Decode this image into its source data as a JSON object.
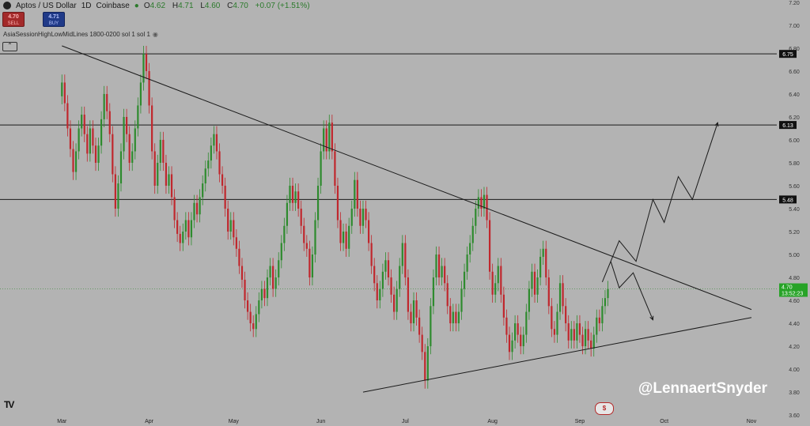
{
  "header": {
    "symbol": "Aptos / US Dollar",
    "interval": "1D",
    "exchange": "Coinbase",
    "o_label": "O",
    "o_value": "4.62",
    "h_label": "H",
    "h_value": "4.71",
    "l_label": "L",
    "l_value": "4.60",
    "c_label": "C",
    "c_value": "4.70",
    "change": "+0.07 (+1.51%)"
  },
  "trade": {
    "sell_price": "4.70",
    "sell_label": "SELL",
    "buy_price": "4.71",
    "buy_label": "BUY"
  },
  "indicator": {
    "label": "AsiaSessionHighLowMidLines 1800-0200 sol 1 sol 1",
    "collapse_glyph": "⌃"
  },
  "watermark": "@LennaertSnyder",
  "icons": {
    "logo": "aptos-logo-icon",
    "eye": "eye-icon",
    "tv": "tradingview-icon",
    "events": "earnings-event-icon"
  },
  "colors": {
    "background": "#b3b3b3",
    "up": "#2e8b2e",
    "down": "#c0272d",
    "line": "#1a1a1a",
    "last_price": "#27a327"
  },
  "chart_data": {
    "type": "candlestick",
    "title": "Aptos / US Dollar",
    "x_ticks": [
      {
        "label": "Mar",
        "t": 0
      },
      {
        "label": "Apr",
        "t": 31
      },
      {
        "label": "May",
        "t": 61
      },
      {
        "label": "Jun",
        "t": 92
      },
      {
        "label": "Jul",
        "t": 122
      },
      {
        "label": "Aug",
        "t": 153
      },
      {
        "label": "Sep",
        "t": 184
      },
      {
        "label": "Oct",
        "t": 214
      },
      {
        "label": "Nov",
        "t": 245
      }
    ],
    "x_range": [
      -22,
      254
    ],
    "ylim": [
      3.58,
      7.22
    ],
    "y_ticks": [
      "7.20",
      "7.00",
      "6.80",
      "6.60",
      "6.40",
      "6.20",
      "6.00",
      "5.80",
      "5.60",
      "5.40",
      "5.20",
      "5.00",
      "4.80",
      "4.60",
      "4.40",
      "4.20",
      "4.00",
      "3.80",
      "3.60"
    ],
    "horizontal_levels": [
      {
        "label": "6.75",
        "value": 6.75
      },
      {
        "label": "6.13",
        "value": 6.13
      },
      {
        "label": "5.48",
        "value": 5.48
      }
    ],
    "last_price": {
      "value": 4.7,
      "label": "4.70",
      "countdown": "13:52:23"
    },
    "trendlines": [
      {
        "points": [
          [
            0,
            6.82
          ],
          [
            245,
            4.52
          ]
        ]
      },
      {
        "points": [
          [
            107,
            3.8
          ],
          [
            245,
            4.45
          ]
        ]
      }
    ],
    "projection_up": [
      [
        192,
        4.76
      ],
      [
        198,
        5.12
      ],
      [
        204,
        4.94
      ],
      [
        210,
        5.48
      ],
      [
        214,
        5.28
      ],
      [
        219,
        5.68
      ],
      [
        224,
        5.48
      ],
      [
        233,
        6.15
      ]
    ],
    "projection_down": [
      [
        195,
        4.94
      ],
      [
        198,
        4.71
      ],
      [
        203,
        4.84
      ],
      [
        210,
        4.43
      ]
    ],
    "candles": [
      {
        "o": 6.38,
        "c": 6.5
      },
      {
        "o": 6.5,
        "c": 6.32
      },
      {
        "o": 6.32,
        "c": 6.1
      },
      {
        "o": 6.1,
        "c": 5.92
      },
      {
        "o": 5.92,
        "c": 5.72
      },
      {
        "o": 5.72,
        "c": 5.9
      },
      {
        "o": 5.9,
        "c": 6.1
      },
      {
        "o": 6.1,
        "c": 6.22
      },
      {
        "o": 6.22,
        "c": 6.05
      },
      {
        "o": 6.05,
        "c": 5.88
      },
      {
        "o": 5.88,
        "c": 6.1
      },
      {
        "o": 6.1,
        "c": 5.95
      },
      {
        "o": 5.95,
        "c": 5.8
      },
      {
        "o": 5.8,
        "c": 5.95
      },
      {
        "o": 5.95,
        "c": 6.18
      },
      {
        "o": 6.18,
        "c": 6.4
      },
      {
        "o": 6.4,
        "c": 6.25
      },
      {
        "o": 6.25,
        "c": 6.05
      },
      {
        "o": 6.05,
        "c": 5.7
      },
      {
        "o": 5.7,
        "c": 5.4
      },
      {
        "o": 5.4,
        "c": 5.62
      },
      {
        "o": 5.62,
        "c": 5.9
      },
      {
        "o": 5.9,
        "c": 6.2
      },
      {
        "o": 6.2,
        "c": 6.05
      },
      {
        "o": 6.05,
        "c": 5.8
      },
      {
        "o": 5.8,
        "c": 5.9
      },
      {
        "o": 5.9,
        "c": 6.1
      },
      {
        "o": 6.1,
        "c": 6.3
      },
      {
        "o": 6.3,
        "c": 6.5
      },
      {
        "o": 6.5,
        "c": 6.75
      },
      {
        "o": 6.75,
        "c": 6.6
      },
      {
        "o": 6.6,
        "c": 6.3
      },
      {
        "o": 6.3,
        "c": 5.9
      },
      {
        "o": 5.9,
        "c": 5.6
      },
      {
        "o": 5.6,
        "c": 5.8
      },
      {
        "o": 5.8,
        "c": 6.0
      },
      {
        "o": 6.0,
        "c": 5.8
      },
      {
        "o": 5.8,
        "c": 5.6
      },
      {
        "o": 5.6,
        "c": 5.7
      },
      {
        "o": 5.7,
        "c": 5.5
      },
      {
        "o": 5.5,
        "c": 5.3
      },
      {
        "o": 5.3,
        "c": 5.18
      },
      {
        "o": 5.18,
        "c": 5.1
      },
      {
        "o": 5.1,
        "c": 5.2
      },
      {
        "o": 5.2,
        "c": 5.3
      },
      {
        "o": 5.3,
        "c": 5.15
      },
      {
        "o": 5.15,
        "c": 5.3
      },
      {
        "o": 5.3,
        "c": 5.45
      },
      {
        "o": 5.45,
        "c": 5.35
      },
      {
        "o": 5.35,
        "c": 5.5
      },
      {
        "o": 5.5,
        "c": 5.62
      },
      {
        "o": 5.62,
        "c": 5.75
      },
      {
        "o": 5.75,
        "c": 5.82
      },
      {
        "o": 5.82,
        "c": 5.95
      },
      {
        "o": 5.95,
        "c": 6.05
      },
      {
        "o": 6.05,
        "c": 5.9
      },
      {
        "o": 5.9,
        "c": 5.7
      },
      {
        "o": 5.7,
        "c": 5.6
      },
      {
        "o": 5.6,
        "c": 5.4
      },
      {
        "o": 5.4,
        "c": 5.2
      },
      {
        "o": 5.2,
        "c": 5.3
      },
      {
        "o": 5.3,
        "c": 5.15
      },
      {
        "o": 5.15,
        "c": 5.05
      },
      {
        "o": 5.05,
        "c": 4.9
      },
      {
        "o": 4.9,
        "c": 4.78
      },
      {
        "o": 4.78,
        "c": 4.6
      },
      {
        "o": 4.6,
        "c": 4.5
      },
      {
        "o": 4.5,
        "c": 4.4
      },
      {
        "o": 4.4,
        "c": 4.35
      },
      {
        "o": 4.35,
        "c": 4.48
      },
      {
        "o": 4.48,
        "c": 4.6
      },
      {
        "o": 4.6,
        "c": 4.7
      },
      {
        "o": 4.7,
        "c": 4.62
      },
      {
        "o": 4.62,
        "c": 4.8
      },
      {
        "o": 4.8,
        "c": 4.9
      },
      {
        "o": 4.9,
        "c": 4.7
      },
      {
        "o": 4.7,
        "c": 4.8
      },
      {
        "o": 4.8,
        "c": 4.95
      },
      {
        "o": 4.95,
        "c": 5.1
      },
      {
        "o": 5.1,
        "c": 5.25
      },
      {
        "o": 5.25,
        "c": 5.45
      },
      {
        "o": 5.45,
        "c": 5.6
      },
      {
        "o": 5.6,
        "c": 5.45
      },
      {
        "o": 5.45,
        "c": 5.55
      },
      {
        "o": 5.55,
        "c": 5.4
      },
      {
        "o": 5.4,
        "c": 5.25
      },
      {
        "o": 5.25,
        "c": 5.1
      },
      {
        "o": 5.1,
        "c": 5.05
      },
      {
        "o": 5.05,
        "c": 4.8
      },
      {
        "o": 4.8,
        "c": 5.0
      },
      {
        "o": 5.0,
        "c": 5.3
      },
      {
        "o": 5.3,
        "c": 5.6
      },
      {
        "o": 5.6,
        "c": 5.9
      },
      {
        "o": 5.9,
        "c": 6.1
      },
      {
        "o": 6.1,
        "c": 5.9
      },
      {
        "o": 5.9,
        "c": 6.15
      },
      {
        "o": 6.15,
        "c": 5.9
      },
      {
        "o": 5.9,
        "c": 5.6
      },
      {
        "o": 5.6,
        "c": 5.3
      },
      {
        "o": 5.3,
        "c": 5.1
      },
      {
        "o": 5.1,
        "c": 5.2
      },
      {
        "o": 5.2,
        "c": 5.05
      },
      {
        "o": 5.05,
        "c": 5.25
      },
      {
        "o": 5.25,
        "c": 5.4
      },
      {
        "o": 5.4,
        "c": 5.65
      },
      {
        "o": 5.65,
        "c": 5.4
      },
      {
        "o": 5.4,
        "c": 5.25
      },
      {
        "o": 5.25,
        "c": 5.4
      },
      {
        "o": 5.4,
        "c": 5.3
      },
      {
        "o": 5.3,
        "c": 5.1
      },
      {
        "o": 5.1,
        "c": 4.9
      },
      {
        "o": 4.9,
        "c": 4.75
      },
      {
        "o": 4.75,
        "c": 4.6
      },
      {
        "o": 4.6,
        "c": 4.7
      },
      {
        "o": 4.7,
        "c": 4.85
      },
      {
        "o": 4.85,
        "c": 4.95
      },
      {
        "o": 4.95,
        "c": 4.8
      },
      {
        "o": 4.8,
        "c": 4.65
      },
      {
        "o": 4.65,
        "c": 4.5
      },
      {
        "o": 4.5,
        "c": 4.7
      },
      {
        "o": 4.7,
        "c": 4.9
      },
      {
        "o": 4.9,
        "c": 5.1
      },
      {
        "o": 5.1,
        "c": 4.8
      },
      {
        "o": 4.8,
        "c": 4.5
      },
      {
        "o": 4.5,
        "c": 4.4
      },
      {
        "o": 4.4,
        "c": 4.6
      },
      {
        "o": 4.6,
        "c": 4.45
      },
      {
        "o": 4.45,
        "c": 4.3
      },
      {
        "o": 4.3,
        "c": 4.15
      },
      {
        "o": 4.15,
        "c": 3.9
      },
      {
        "o": 3.9,
        "c": 4.2
      },
      {
        "o": 4.2,
        "c": 4.55
      },
      {
        "o": 4.55,
        "c": 4.8
      },
      {
        "o": 4.8,
        "c": 5.0
      },
      {
        "o": 5.0,
        "c": 4.8
      },
      {
        "o": 4.8,
        "c": 4.9
      },
      {
        "o": 4.9,
        "c": 4.75
      },
      {
        "o": 4.75,
        "c": 4.55
      },
      {
        "o": 4.55,
        "c": 4.4
      },
      {
        "o": 4.4,
        "c": 4.5
      },
      {
        "o": 4.5,
        "c": 4.4
      },
      {
        "o": 4.4,
        "c": 4.5
      },
      {
        "o": 4.5,
        "c": 4.7
      },
      {
        "o": 4.7,
        "c": 4.85
      },
      {
        "o": 4.85,
        "c": 5.0
      },
      {
        "o": 5.0,
        "c": 5.1
      },
      {
        "o": 5.1,
        "c": 5.25
      },
      {
        "o": 5.25,
        "c": 5.4
      },
      {
        "o": 5.4,
        "c": 5.5
      },
      {
        "o": 5.5,
        "c": 5.4
      },
      {
        "o": 5.4,
        "c": 5.52
      },
      {
        "o": 5.52,
        "c": 5.3
      },
      {
        "o": 5.3,
        "c": 4.85
      },
      {
        "o": 4.85,
        "c": 4.65
      },
      {
        "o": 4.65,
        "c": 4.75
      },
      {
        "o": 4.75,
        "c": 4.9
      },
      {
        "o": 4.9,
        "c": 4.65
      },
      {
        "o": 4.65,
        "c": 4.45
      },
      {
        "o": 4.45,
        "c": 4.3
      },
      {
        "o": 4.3,
        "c": 4.15
      },
      {
        "o": 4.15,
        "c": 4.25
      },
      {
        "o": 4.25,
        "c": 4.4
      },
      {
        "o": 4.4,
        "c": 4.3
      },
      {
        "o": 4.3,
        "c": 4.2
      },
      {
        "o": 4.2,
        "c": 4.3
      },
      {
        "o": 4.3,
        "c": 4.5
      },
      {
        "o": 4.5,
        "c": 4.7
      },
      {
        "o": 4.7,
        "c": 4.85
      },
      {
        "o": 4.85,
        "c": 4.65
      },
      {
        "o": 4.65,
        "c": 4.8
      },
      {
        "o": 4.8,
        "c": 4.98
      },
      {
        "o": 4.98,
        "c": 5.05
      },
      {
        "o": 5.05,
        "c": 4.8
      },
      {
        "o": 4.8,
        "c": 4.55
      },
      {
        "o": 4.55,
        "c": 4.35
      },
      {
        "o": 4.35,
        "c": 4.3
      },
      {
        "o": 4.3,
        "c": 4.5
      },
      {
        "o": 4.5,
        "c": 4.75
      },
      {
        "o": 4.75,
        "c": 4.55
      },
      {
        "o": 4.55,
        "c": 4.4
      },
      {
        "o": 4.4,
        "c": 4.25
      },
      {
        "o": 4.25,
        "c": 4.35
      },
      {
        "o": 4.35,
        "c": 4.25
      },
      {
        "o": 4.25,
        "c": 4.4
      },
      {
        "o": 4.4,
        "c": 4.3
      },
      {
        "o": 4.3,
        "c": 4.2
      },
      {
        "o": 4.2,
        "c": 4.35
      },
      {
        "o": 4.35,
        "c": 4.25
      },
      {
        "o": 4.25,
        "c": 4.18
      },
      {
        "o": 4.18,
        "c": 4.3
      },
      {
        "o": 4.3,
        "c": 4.45
      },
      {
        "o": 4.45,
        "c": 4.4
      },
      {
        "o": 4.4,
        "c": 4.55
      },
      {
        "o": 4.55,
        "c": 4.62
      },
      {
        "o": 4.62,
        "c": 4.7
      }
    ]
  }
}
